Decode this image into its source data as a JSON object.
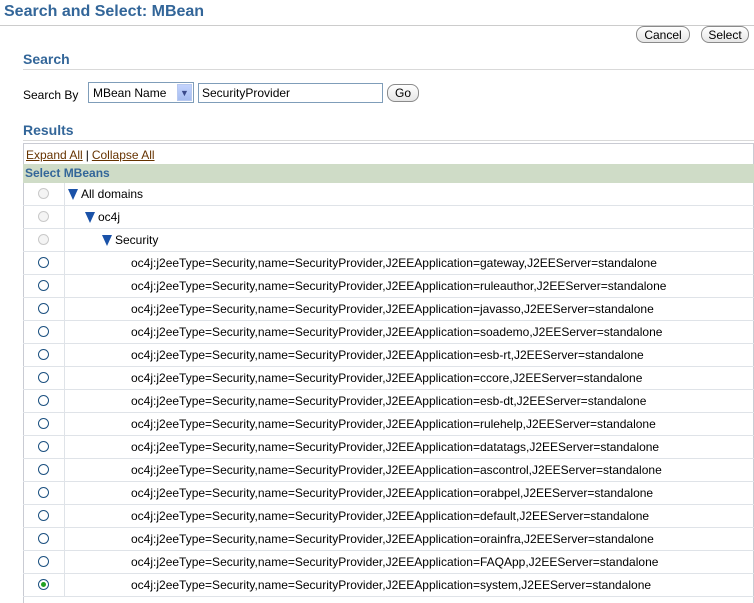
{
  "page": {
    "title": "Search and Select: MBean",
    "cancel_label": "Cancel",
    "select_label": "Select"
  },
  "search": {
    "section_title": "Search",
    "search_by_label": "Search By",
    "search_by_value": "MBean Name",
    "query": "SecurityProvider",
    "go_label": "Go"
  },
  "results": {
    "section_title": "Results",
    "expand_all": "Expand All",
    "separator": "|",
    "collapse_all": "Collapse All",
    "column_header": "Select MBeans",
    "tree": [
      {
        "label": "All domains",
        "type": "folder",
        "level": 0
      },
      {
        "label": "oc4j",
        "type": "folder",
        "level": 1
      },
      {
        "label": "Security",
        "type": "folder",
        "level": 2
      }
    ],
    "items": [
      {
        "label": "oc4j:j2eeType=Security,name=SecurityProvider,J2EEApplication=gateway,J2EEServer=standalone",
        "checked": false
      },
      {
        "label": "oc4j:j2eeType=Security,name=SecurityProvider,J2EEApplication=ruleauthor,J2EEServer=standalone",
        "checked": false
      },
      {
        "label": "oc4j:j2eeType=Security,name=SecurityProvider,J2EEApplication=javasso,J2EEServer=standalone",
        "checked": false
      },
      {
        "label": "oc4j:j2eeType=Security,name=SecurityProvider,J2EEApplication=soademo,J2EEServer=standalone",
        "checked": false
      },
      {
        "label": "oc4j:j2eeType=Security,name=SecurityProvider,J2EEApplication=esb-rt,J2EEServer=standalone",
        "checked": false
      },
      {
        "label": "oc4j:j2eeType=Security,name=SecurityProvider,J2EEApplication=ccore,J2EEServer=standalone",
        "checked": false
      },
      {
        "label": "oc4j:j2eeType=Security,name=SecurityProvider,J2EEApplication=esb-dt,J2EEServer=standalone",
        "checked": false
      },
      {
        "label": "oc4j:j2eeType=Security,name=SecurityProvider,J2EEApplication=rulehelp,J2EEServer=standalone",
        "checked": false
      },
      {
        "label": "oc4j:j2eeType=Security,name=SecurityProvider,J2EEApplication=datatags,J2EEServer=standalone",
        "checked": false
      },
      {
        "label": "oc4j:j2eeType=Security,name=SecurityProvider,J2EEApplication=ascontrol,J2EEServer=standalone",
        "checked": false
      },
      {
        "label": "oc4j:j2eeType=Security,name=SecurityProvider,J2EEApplication=orabpel,J2EEServer=standalone",
        "checked": false
      },
      {
        "label": "oc4j:j2eeType=Security,name=SecurityProvider,J2EEApplication=default,J2EEServer=standalone",
        "checked": false
      },
      {
        "label": "oc4j:j2eeType=Security,name=SecurityProvider,J2EEApplication=orainfra,J2EEServer=standalone",
        "checked": false
      },
      {
        "label": "oc4j:j2eeType=Security,name=SecurityProvider,J2EEApplication=FAQApp,J2EEServer=standalone",
        "checked": false
      },
      {
        "label": "oc4j:j2eeType=Security,name=SecurityProvider,J2EEApplication=system,J2EEServer=standalone",
        "checked": true
      }
    ]
  },
  "colors": {
    "heading": "#336699",
    "link": "#663300",
    "header_bg": "#cfdcc7",
    "selected_radio": "#21a121"
  }
}
